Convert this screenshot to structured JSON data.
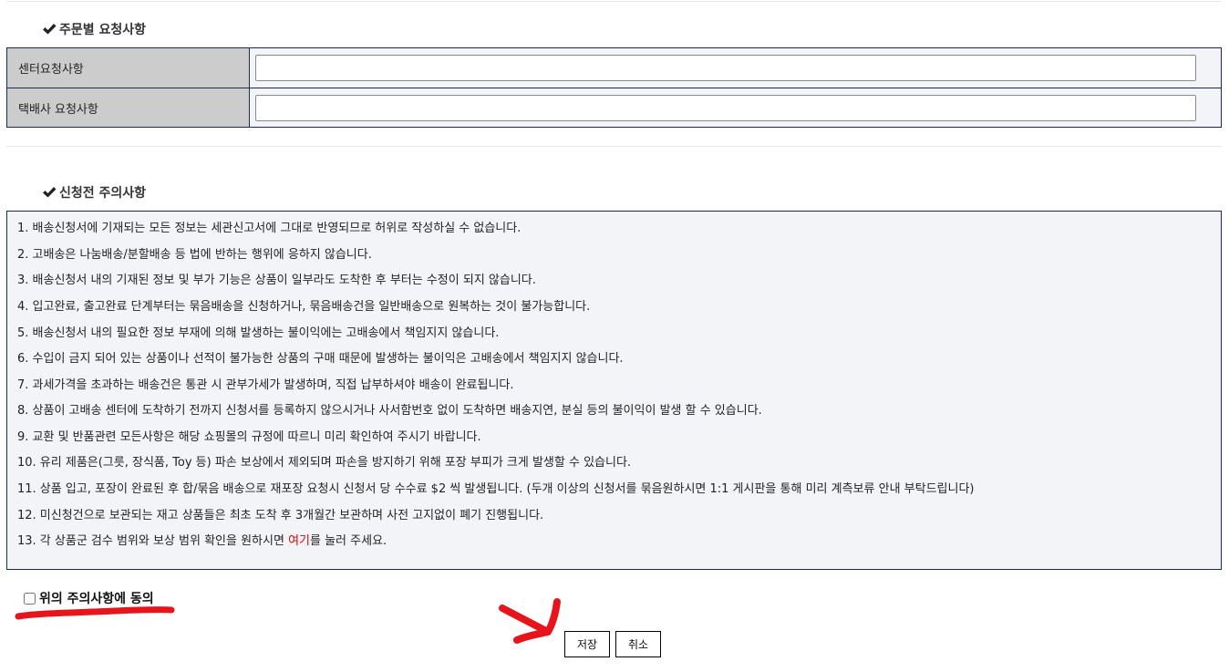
{
  "order_requests": {
    "title": "주문별 요청사항",
    "rows": [
      {
        "label": "센터요청사항",
        "value": "",
        "placeholder": ""
      },
      {
        "label": "택배사 요청사항",
        "value": "",
        "placeholder": ""
      }
    ]
  },
  "notice": {
    "title": "신청전 주의사항",
    "items": [
      "1. 배송신청서에 기재되는 모든 정보는 세관신고서에 그대로 반영되므로 허위로 작성하실 수 없습니다.",
      "2. 고배송은 나눔배송/분할배송 등 법에 반하는 행위에 응하지 않습니다.",
      "3. 배송신청서 내의 기재된 정보 및 부가 기능은 상품이 일부라도 도착한 후 부터는 수정이 되지 않습니다.",
      "4. 입고완료, 출고완료 단계부터는 묶음배송을 신청하거나, 묶음배송건을 일반배송으로 원복하는 것이 불가능합니다.",
      "5. 배송신청서 내의 필요한 정보 부재에 의해 발생하는 불이익에는 고배송에서 책임지지 않습니다.",
      "6. 수입이 금지 되어 있는 상품이나 선적이 불가능한 상품의 구매 때문에 발생하는 불이익은 고배송에서 책임지지 않습니다.",
      "7. 과세가격을 초과하는 배송건은 통관 시 관부가세가 발생하며, 직접 납부하셔야 배송이 완료됩니다.",
      "8. 상품이 고배송 센터에 도착하기 전까지 신청서를 등록하지 않으시거나 사서함번호 없이 도착하면 배송지연, 분실 등의 불이익이 발생 할 수 있습니다.",
      "9. 교환 및 반품관련 모든사항은 해당 쇼핑몰의 규정에 따르니 미리 확인하여 주시기 바랍니다.",
      "10. 유리 제품은(그릇, 장식품, Toy 등) 파손 보상에서 제외되며 파손을 방지하기 위해 포장 부피가 크게 발생할 수 있습니다.",
      "11. 상품 입고, 포장이 완료된 후 합/묶음 배송으로 재포장 요청시 신청서 당 수수료 $2 씩 발생됩니다. (두개 이상의 신청서를 묶음원하시면 1:1 게시판을 통해 미리 계측보류 안내 부탁드립니다)",
      "12. 미신청건으로 보관되는 재고 상품들은 최초 도착 후 3개월간 보관하며 사전 고지없이 폐기 진행됩니다."
    ],
    "item13": {
      "before": "13. 각 상품군 검수 범위와 보상 범위 확인을 원하시면 ",
      "link": "여기",
      "after": "를 눌러 주세요."
    }
  },
  "agree": {
    "label": "위의 주의사항에 동의",
    "checked": false
  },
  "buttons": {
    "save": "저장",
    "cancel": "취소"
  },
  "colors": {
    "border": "#1c2a4f",
    "label_bg": "#cccccc",
    "panel_bg": "#f3f4f8",
    "link": "#e00000",
    "annotation": "#e8141c"
  },
  "icons": {
    "section_title": "check-mark-icon"
  }
}
